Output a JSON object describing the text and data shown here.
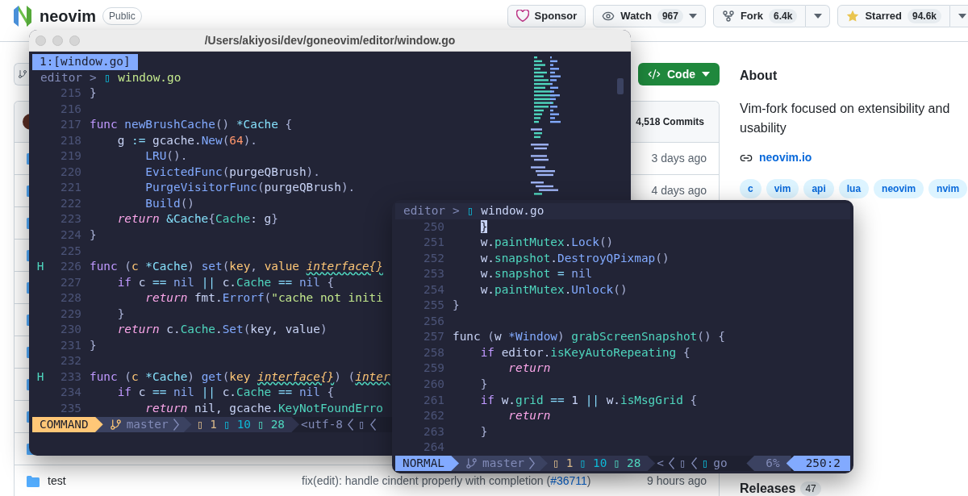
{
  "repo": {
    "name": "neovim",
    "visibility": "Public"
  },
  "actions": [
    {
      "kind": "sponsor",
      "label": "Sponsor"
    },
    {
      "kind": "watch",
      "label": "Watch",
      "count": "967"
    },
    {
      "kind": "fork",
      "label": "Fork",
      "count": "6.4k"
    },
    {
      "kind": "star",
      "label": "Starred",
      "count": "94.6k"
    }
  ],
  "code_button": "Code",
  "commits": "4,518 Commits",
  "files": [
    {
      "kind": "folder",
      "date": "3 days ago"
    },
    {
      "kind": "folder",
      "date": "4 days ago"
    },
    {
      "kind": "folder"
    },
    {
      "kind": "folder"
    },
    {
      "kind": "folder"
    },
    {
      "kind": "folder"
    },
    {
      "kind": "folder"
    },
    {
      "kind": "folder"
    },
    {
      "kind": "folder"
    },
    {
      "kind": "folder"
    },
    {
      "kind": "folder",
      "name": "test",
      "message": [
        "fix(edit): handle cindent properly with completion (",
        "#36711",
        ")"
      ],
      "date": "9 hours ago"
    }
  ],
  "about": {
    "title": "About",
    "description": "Vim-fork focused on extensibility and usability",
    "link": "neovim.io",
    "topics": [
      "c",
      "vim",
      "api",
      "lua",
      "neovim",
      "nvim"
    ]
  },
  "releases": {
    "title": "Releases",
    "count": "47"
  },
  "windows": [
    {
      "kind": "app-window",
      "title": "/Users/akiyosi/dev/goneovim/editor/window.go",
      "tabs": [
        {
          "label": "1:[window.go]",
          "selected": true
        }
      ],
      "breadcrumb": {
        "folder": "editor",
        "separator": ">",
        "icon": "▯",
        "file": "window.go",
        "file_highlighted": true
      },
      "lines": [
        {
          "number": "215",
          "tokens": [
            {
              "text": "}",
              "kind": "punc"
            }
          ]
        },
        {
          "number": "216"
        },
        {
          "number": "217",
          "tokens": [
            {
              "text": "func",
              "kind": "kw"
            },
            {
              "text": " newBrushCache",
              "kind": "fn"
            },
            {
              "text": "()",
              "kind": "punc"
            },
            {
              "text": " *Cache",
              "kind": "type"
            },
            {
              "text": " {",
              "kind": "punc"
            }
          ]
        },
        {
          "number": "218",
          "tokens": [
            {
              "text": "    g ",
              "kind": "plain"
            },
            {
              "text": ":=",
              "kind": "op"
            },
            {
              "text": " gcache.",
              "kind": "plain"
            },
            {
              "text": "New",
              "kind": "fn"
            },
            {
              "text": "(",
              "kind": "punc"
            },
            {
              "text": "64",
              "kind": "num"
            },
            {
              "text": ").",
              "kind": "punc"
            }
          ]
        },
        {
          "number": "219",
          "tokens": [
            {
              "text": "        LRU",
              "kind": "fn"
            },
            {
              "text": "().",
              "kind": "punc"
            }
          ]
        },
        {
          "number": "220",
          "tokens": [
            {
              "text": "        EvictedFunc",
              "kind": "fn"
            },
            {
              "text": "(",
              "kind": "punc"
            },
            {
              "text": "purgeQBrush",
              "kind": "plain"
            },
            {
              "text": ").",
              "kind": "punc"
            }
          ]
        },
        {
          "number": "221",
          "tokens": [
            {
              "text": "        PurgeVisitorFunc",
              "kind": "fn"
            },
            {
              "text": "(",
              "kind": "punc"
            },
            {
              "text": "purgeQBrush",
              "kind": "plain"
            },
            {
              "text": ").",
              "kind": "punc"
            }
          ]
        },
        {
          "number": "222",
          "tokens": [
            {
              "text": "        Build",
              "kind": "fn"
            },
            {
              "text": "()",
              "kind": "punc"
            }
          ]
        },
        {
          "number": "223",
          "tokens": [
            {
              "text": "    return",
              "kind": "ret"
            },
            {
              "text": " &Cache",
              "kind": "type"
            },
            {
              "text": "{",
              "kind": "punc"
            },
            {
              "text": "Cache",
              "kind": "field"
            },
            {
              "text": ": g",
              "kind": "plain"
            },
            {
              "text": "}",
              "kind": "punc"
            }
          ]
        },
        {
          "number": "224",
          "tokens": [
            {
              "text": "}",
              "kind": "punc"
            }
          ]
        },
        {
          "number": "225"
        },
        {
          "number": "226",
          "sign": "H",
          "tokens": [
            {
              "text": "func",
              "kind": "kw"
            },
            {
              "text": " (",
              "kind": "punc"
            },
            {
              "text": "c",
              "kind": "param"
            },
            {
              "text": " *Cache",
              "kind": "type"
            },
            {
              "text": ") ",
              "kind": "punc"
            },
            {
              "text": "set",
              "kind": "fn"
            },
            {
              "text": "(",
              "kind": "punc"
            },
            {
              "text": "key",
              "kind": "param"
            },
            {
              "text": ", ",
              "kind": "punc"
            },
            {
              "text": "value ",
              "kind": "param"
            },
            {
              "text": "interface{}",
              "kind": "curl"
            }
          ]
        },
        {
          "number": "227",
          "tokens": [
            {
              "text": "    if",
              "kind": "kw"
            },
            {
              "text": " c ",
              "kind": "plain"
            },
            {
              "text": "==",
              "kind": "op"
            },
            {
              "text": " nil",
              "kind": "nil"
            },
            {
              "text": " ||",
              "kind": "op"
            },
            {
              "text": " c.",
              "kind": "plain"
            },
            {
              "text": "Cache",
              "kind": "field"
            },
            {
              "text": " ==",
              "kind": "op"
            },
            {
              "text": " nil",
              "kind": "nil"
            },
            {
              "text": " {",
              "kind": "punc"
            }
          ]
        },
        {
          "number": "228",
          "tokens": [
            {
              "text": "        return",
              "kind": "ret"
            },
            {
              "text": " fmt.",
              "kind": "plain"
            },
            {
              "text": "Errorf",
              "kind": "fn"
            },
            {
              "text": "(",
              "kind": "punc"
            },
            {
              "text": "\"cache not initi",
              "kind": "str"
            }
          ]
        },
        {
          "number": "229",
          "tokens": [
            {
              "text": "    }",
              "kind": "punc"
            }
          ]
        },
        {
          "number": "230",
          "tokens": [
            {
              "text": "    return",
              "kind": "ret"
            },
            {
              "text": " c.",
              "kind": "plain"
            },
            {
              "text": "Cache",
              "kind": "field"
            },
            {
              "text": ".",
              "kind": "plain"
            },
            {
              "text": "Set",
              "kind": "fn"
            },
            {
              "text": "(",
              "kind": "punc"
            },
            {
              "text": "key, value",
              "kind": "plain"
            },
            {
              "text": ")",
              "kind": "punc"
            }
          ]
        },
        {
          "number": "231",
          "tokens": [
            {
              "text": "}",
              "kind": "punc"
            }
          ]
        },
        {
          "number": "232"
        },
        {
          "number": "233",
          "sign": "H",
          "tokens": [
            {
              "text": "func",
              "kind": "kw"
            },
            {
              "text": " (",
              "kind": "punc"
            },
            {
              "text": "c",
              "kind": "param"
            },
            {
              "text": " *Cache",
              "kind": "type"
            },
            {
              "text": ") ",
              "kind": "punc"
            },
            {
              "text": "get",
              "kind": "fn"
            },
            {
              "text": "(",
              "kind": "punc"
            },
            {
              "text": "key ",
              "kind": "param"
            },
            {
              "text": "interface{}",
              "kind": "curl"
            },
            {
              "text": ") (",
              "kind": "punc"
            },
            {
              "text": "inter",
              "kind": "curl"
            }
          ]
        },
        {
          "number": "234",
          "tokens": [
            {
              "text": "    if",
              "kind": "kw"
            },
            {
              "text": " c ",
              "kind": "plain"
            },
            {
              "text": "==",
              "kind": "op"
            },
            {
              "text": " nil",
              "kind": "nil"
            },
            {
              "text": " ||",
              "kind": "op"
            },
            {
              "text": " c.",
              "kind": "plain"
            },
            {
              "text": "Cache",
              "kind": "field"
            },
            {
              "text": " ==",
              "kind": "op"
            },
            {
              "text": " nil",
              "kind": "nil"
            },
            {
              "text": " {",
              "kind": "punc"
            }
          ]
        },
        {
          "number": "235",
          "tokens": [
            {
              "text": "        return",
              "kind": "ret"
            },
            {
              "text": " nil, gcache.",
              "kind": "plain"
            },
            {
              "text": "KeyNotFoundErro",
              "kind": "field"
            }
          ]
        }
      ],
      "status": {
        "kind": "command",
        "mode": "COMMAND",
        "branch": "master",
        "diagnostics": [
          {
            "icon": "▯",
            "count": "1",
            "color": "#d9b98a"
          },
          {
            "icon": "▯",
            "count": "10",
            "color": "#0db9d7"
          },
          {
            "icon": "▯",
            "count": "28",
            "color": "#4fd6be"
          }
        ],
        "right": [
          {
            "kind": "text",
            "text": "<utf-8"
          },
          {
            "kind": "chevron"
          },
          {
            "kind": "text",
            "text": "▯"
          },
          {
            "kind": "chevron"
          }
        ]
      }
    },
    {
      "kind": "floating-window",
      "breadcrumb": {
        "folder": "editor",
        "separator": ">",
        "icon": "▯",
        "file": "window.go",
        "file_highlighted": false
      },
      "lines": [
        {
          "number": "250",
          "tokens": [
            {
              "text": "    }",
              "kind": "cursor"
            }
          ]
        },
        {
          "number": "251",
          "tokens": [
            {
              "text": "    w.",
              "kind": "plain"
            },
            {
              "text": "paintMutex",
              "kind": "field"
            },
            {
              "text": ".",
              "kind": "plain"
            },
            {
              "text": "Lock",
              "kind": "fn"
            },
            {
              "text": "()",
              "kind": "punc"
            }
          ]
        },
        {
          "number": "252",
          "tokens": [
            {
              "text": "    w.",
              "kind": "plain"
            },
            {
              "text": "snapshot",
              "kind": "field"
            },
            {
              "text": ".",
              "kind": "plain"
            },
            {
              "text": "DestroyQPixmap",
              "kind": "fn"
            },
            {
              "text": "()",
              "kind": "punc"
            }
          ]
        },
        {
          "number": "253",
          "tokens": [
            {
              "text": "    w.",
              "kind": "plain"
            },
            {
              "text": "snapshot",
              "kind": "field"
            },
            {
              "text": " =",
              "kind": "op"
            },
            {
              "text": " nil",
              "kind": "nil"
            }
          ]
        },
        {
          "number": "254",
          "tokens": [
            {
              "text": "    w.",
              "kind": "plain"
            },
            {
              "text": "paintMutex",
              "kind": "field"
            },
            {
              "text": ".",
              "kind": "plain"
            },
            {
              "text": "Unlock",
              "kind": "fn"
            },
            {
              "text": "()",
              "kind": "punc"
            }
          ]
        },
        {
          "number": "255",
          "tokens": [
            {
              "text": "}",
              "kind": "punc"
            }
          ]
        },
        {
          "number": "256"
        },
        {
          "number": "257",
          "tokens": [
            {
              "text": "func",
              "kind": "plain"
            },
            {
              "text": " (",
              "kind": "punc"
            },
            {
              "text": "w ",
              "kind": "plain"
            },
            {
              "text": "*Window",
              "kind": "fn"
            },
            {
              "text": ") ",
              "kind": "punc"
            },
            {
              "text": "grabScreenSnapshot",
              "kind": "field"
            },
            {
              "text": "() {",
              "kind": "punc"
            }
          ]
        },
        {
          "number": "258",
          "tokens": [
            {
              "text": "    if",
              "kind": "kw"
            },
            {
              "text": " editor.",
              "kind": "plain"
            },
            {
              "text": "isKeyAutoRepeating",
              "kind": "field"
            },
            {
              "text": " {",
              "kind": "punc"
            }
          ]
        },
        {
          "number": "259",
          "tokens": [
            {
              "text": "        return",
              "kind": "ret"
            }
          ]
        },
        {
          "number": "260",
          "tokens": [
            {
              "text": "    }",
              "kind": "punc"
            }
          ]
        },
        {
          "number": "261",
          "tokens": [
            {
              "text": "    if",
              "kind": "kw"
            },
            {
              "text": " w.",
              "kind": "plain"
            },
            {
              "text": "grid",
              "kind": "field"
            },
            {
              "text": " ==",
              "kind": "op"
            },
            {
              "text": " 1 ",
              "kind": "plain"
            },
            {
              "text": "||",
              "kind": "op"
            },
            {
              "text": " w.",
              "kind": "plain"
            },
            {
              "text": "isMsgGrid",
              "kind": "field"
            },
            {
              "text": " {",
              "kind": "punc"
            }
          ]
        },
        {
          "number": "262",
          "tokens": [
            {
              "text": "        return",
              "kind": "ret"
            }
          ]
        },
        {
          "number": "263",
          "tokens": [
            {
              "text": "    }",
              "kind": "punc"
            }
          ]
        },
        {
          "number": "264"
        }
      ],
      "status": {
        "kind": "normal",
        "mode": "NORMAL",
        "branch": "master",
        "diagnostics": [
          {
            "icon": "▯",
            "count": "1",
            "color": "#d9b98a"
          },
          {
            "icon": "▯",
            "count": "10",
            "color": "#0db9d7"
          },
          {
            "icon": "▯",
            "count": "28",
            "color": "#4fd6be"
          }
        ],
        "right": [
          {
            "kind": "text",
            "text": "<"
          },
          {
            "kind": "chevron"
          },
          {
            "kind": "text",
            "text": "▯"
          },
          {
            "kind": "chevron"
          },
          {
            "kind": "filetype",
            "icon": "▯",
            "text": "go"
          }
        ],
        "percent": "6%",
        "position": "250:2"
      }
    }
  ]
}
